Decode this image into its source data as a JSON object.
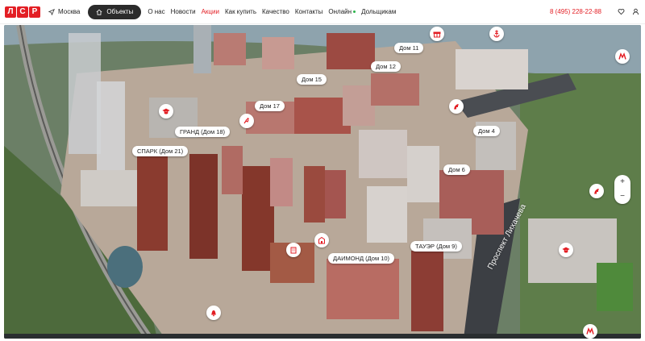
{
  "header": {
    "logo_letters": [
      "Л",
      "С",
      "Р"
    ],
    "city": "Москва",
    "objects_button": "Объекты",
    "nav": [
      {
        "label": "О нас",
        "active": false
      },
      {
        "label": "Новости",
        "active": false
      },
      {
        "label": "Акции",
        "active": true
      },
      {
        "label": "Как купить",
        "active": false
      },
      {
        "label": "Качество",
        "active": false
      },
      {
        "label": "Контакты",
        "active": false
      },
      {
        "label": "Онлайн",
        "active": false
      },
      {
        "label": "Дольщикам",
        "active": false
      }
    ],
    "phone": "8 (495) 228-22-88",
    "accent_color": "#e31e24"
  },
  "map": {
    "building_labels": {
      "dom11": "Дом 11",
      "dom12": "Дом 12",
      "dom15": "Дом 15",
      "dom17": "Дом 17",
      "grand": "ГРАНД (Дом 18)",
      "spark": "СПАРК (Дом 21)",
      "dom4": "Дом 4",
      "dom6": "Дом 6",
      "tower": "ТАУЭР (Дом 9)",
      "diamond": "ДАИМОНД (Дом 10)"
    },
    "street_name": "Проспект Лихачева",
    "zoom_in": "+",
    "zoom_out": "−",
    "pin_icons": [
      "gift-icon",
      "anchor-icon",
      "metro-icon",
      "school-icon",
      "horse-icon",
      "playground-icon",
      "kindergarten-icon",
      "building-icon",
      "bell-icon",
      "sport-icon"
    ]
  }
}
